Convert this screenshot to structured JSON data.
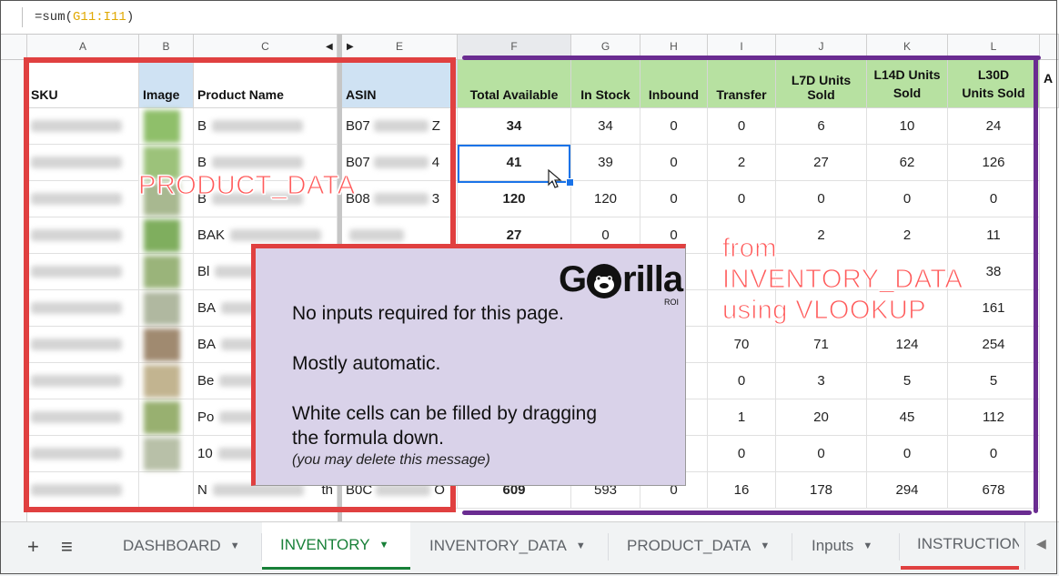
{
  "formula_bar": {
    "prefix": "=sum(",
    "range": "G11:I11",
    "suffix": ")"
  },
  "columns": [
    "A",
    "B",
    "C",
    "E",
    "F",
    "G",
    "H",
    "I",
    "J",
    "K",
    "L"
  ],
  "headers": {
    "sku": "SKU",
    "image": "Image",
    "product_name": "Product Name",
    "asin": "ASIN",
    "total_available": "Total Available",
    "in_stock": "In Stock",
    "inbound": "Inbound",
    "transfer": "Transfer",
    "l7d": "L7D Units Sold",
    "l14d_line1": "L14D Units",
    "l14d_line2": "Sold",
    "l30d_line1": "L30D",
    "l30d_line2": "Units Sold",
    "next_col": "A"
  },
  "rows": [
    {
      "name": "B",
      "asin_a": "B07",
      "asin_b": "Z",
      "total": "34",
      "in_stock": "34",
      "inbound": "0",
      "transfer": "0",
      "l7d": "6",
      "l14d": "10",
      "l30d": "24"
    },
    {
      "name": "B",
      "asin_a": "B07",
      "asin_b": "4",
      "total": "41",
      "in_stock": "39",
      "inbound": "0",
      "transfer": "2",
      "l7d": "27",
      "l14d": "62",
      "l30d": "126"
    },
    {
      "name": "B",
      "asin_a": "B08",
      "asin_b": "3",
      "total": "120",
      "in_stock": "120",
      "inbound": "0",
      "transfer": "0",
      "l7d": "0",
      "l14d": "0",
      "l30d": "0"
    },
    {
      "name": "BAK",
      "asin_a": "",
      "asin_b": "",
      "total": "27",
      "in_stock": "0",
      "inbound": "0",
      "transfer": "",
      "l7d": "2",
      "l14d": "2",
      "l30d": "11"
    },
    {
      "name": "Bl",
      "asin_a": "",
      "asin_b": "",
      "total": "",
      "in_stock": "",
      "inbound": "",
      "transfer": "",
      "l7d": "",
      "l14d": "",
      "l30d": "38"
    },
    {
      "name": "BA",
      "asin_a": "",
      "asin_b": "",
      "total": "",
      "in_stock": "",
      "inbound": "",
      "transfer": "",
      "l7d": "",
      "l14d": "",
      "l30d": "161"
    },
    {
      "name": "BA",
      "asin_a": "",
      "asin_b": "",
      "total": "",
      "in_stock": "",
      "inbound": "",
      "transfer": "70",
      "l7d": "71",
      "l14d": "124",
      "l30d": "254"
    },
    {
      "name": "Be",
      "asin_a": "",
      "asin_b": "",
      "total": "",
      "in_stock": "",
      "inbound": "",
      "transfer": "0",
      "l7d": "3",
      "l14d": "5",
      "l30d": "5"
    },
    {
      "name": "Po",
      "asin_a": "",
      "asin_b": "",
      "total": "",
      "in_stock": "",
      "inbound": "",
      "transfer": "1",
      "l7d": "20",
      "l14d": "45",
      "l30d": "112"
    },
    {
      "name": "10",
      "asin_a": "",
      "asin_b": "",
      "total": "",
      "in_stock": "",
      "inbound": "",
      "transfer": "0",
      "l7d": "0",
      "l14d": "0",
      "l30d": "0"
    },
    {
      "name": "N",
      "asin_a": "B0C",
      "asin_b": "O",
      "total": "609",
      "in_stock": "593",
      "inbound": "0",
      "transfer": "16",
      "l7d": "178",
      "l14d": "294",
      "l30d": "678"
    }
  ],
  "row11_extra": "th",
  "overlays": {
    "product_data": "PRODUCT_DATA",
    "from_line1": "from",
    "from_line2": "INVENTORY_DATA",
    "from_line3": "using VLOOKUP"
  },
  "note": {
    "line1": "No inputs required for this page.",
    "line2": "Mostly automatic.",
    "line3": "White cells can be filled by dragging",
    "line4": "the formula down.",
    "line5": "(you may delete this message)",
    "logo_g": "G",
    "logo_rest": "rilla",
    "logo_roi": "ROI"
  },
  "tabs": [
    {
      "label": "DASHBOARD"
    },
    {
      "label": "INVENTORY"
    },
    {
      "label": "INVENTORY_DATA"
    },
    {
      "label": "PRODUCT_DATA"
    },
    {
      "label": "Inputs"
    },
    {
      "label": "INSTRUCTIONS"
    }
  ],
  "icons": {
    "add": "plus-icon",
    "list": "list-icon",
    "caret": "caret-down-icon",
    "scroll": "chevron-left-icon"
  },
  "colors": {
    "header_green": "#b7e1a1",
    "header_blue": "#cfe2f3",
    "red_annotation": "#e04040",
    "purple_annotation": "#6a2c91",
    "active_tab": "#188038",
    "selection_blue": "#1a73e8",
    "note_bg": "#d9d2e9"
  }
}
